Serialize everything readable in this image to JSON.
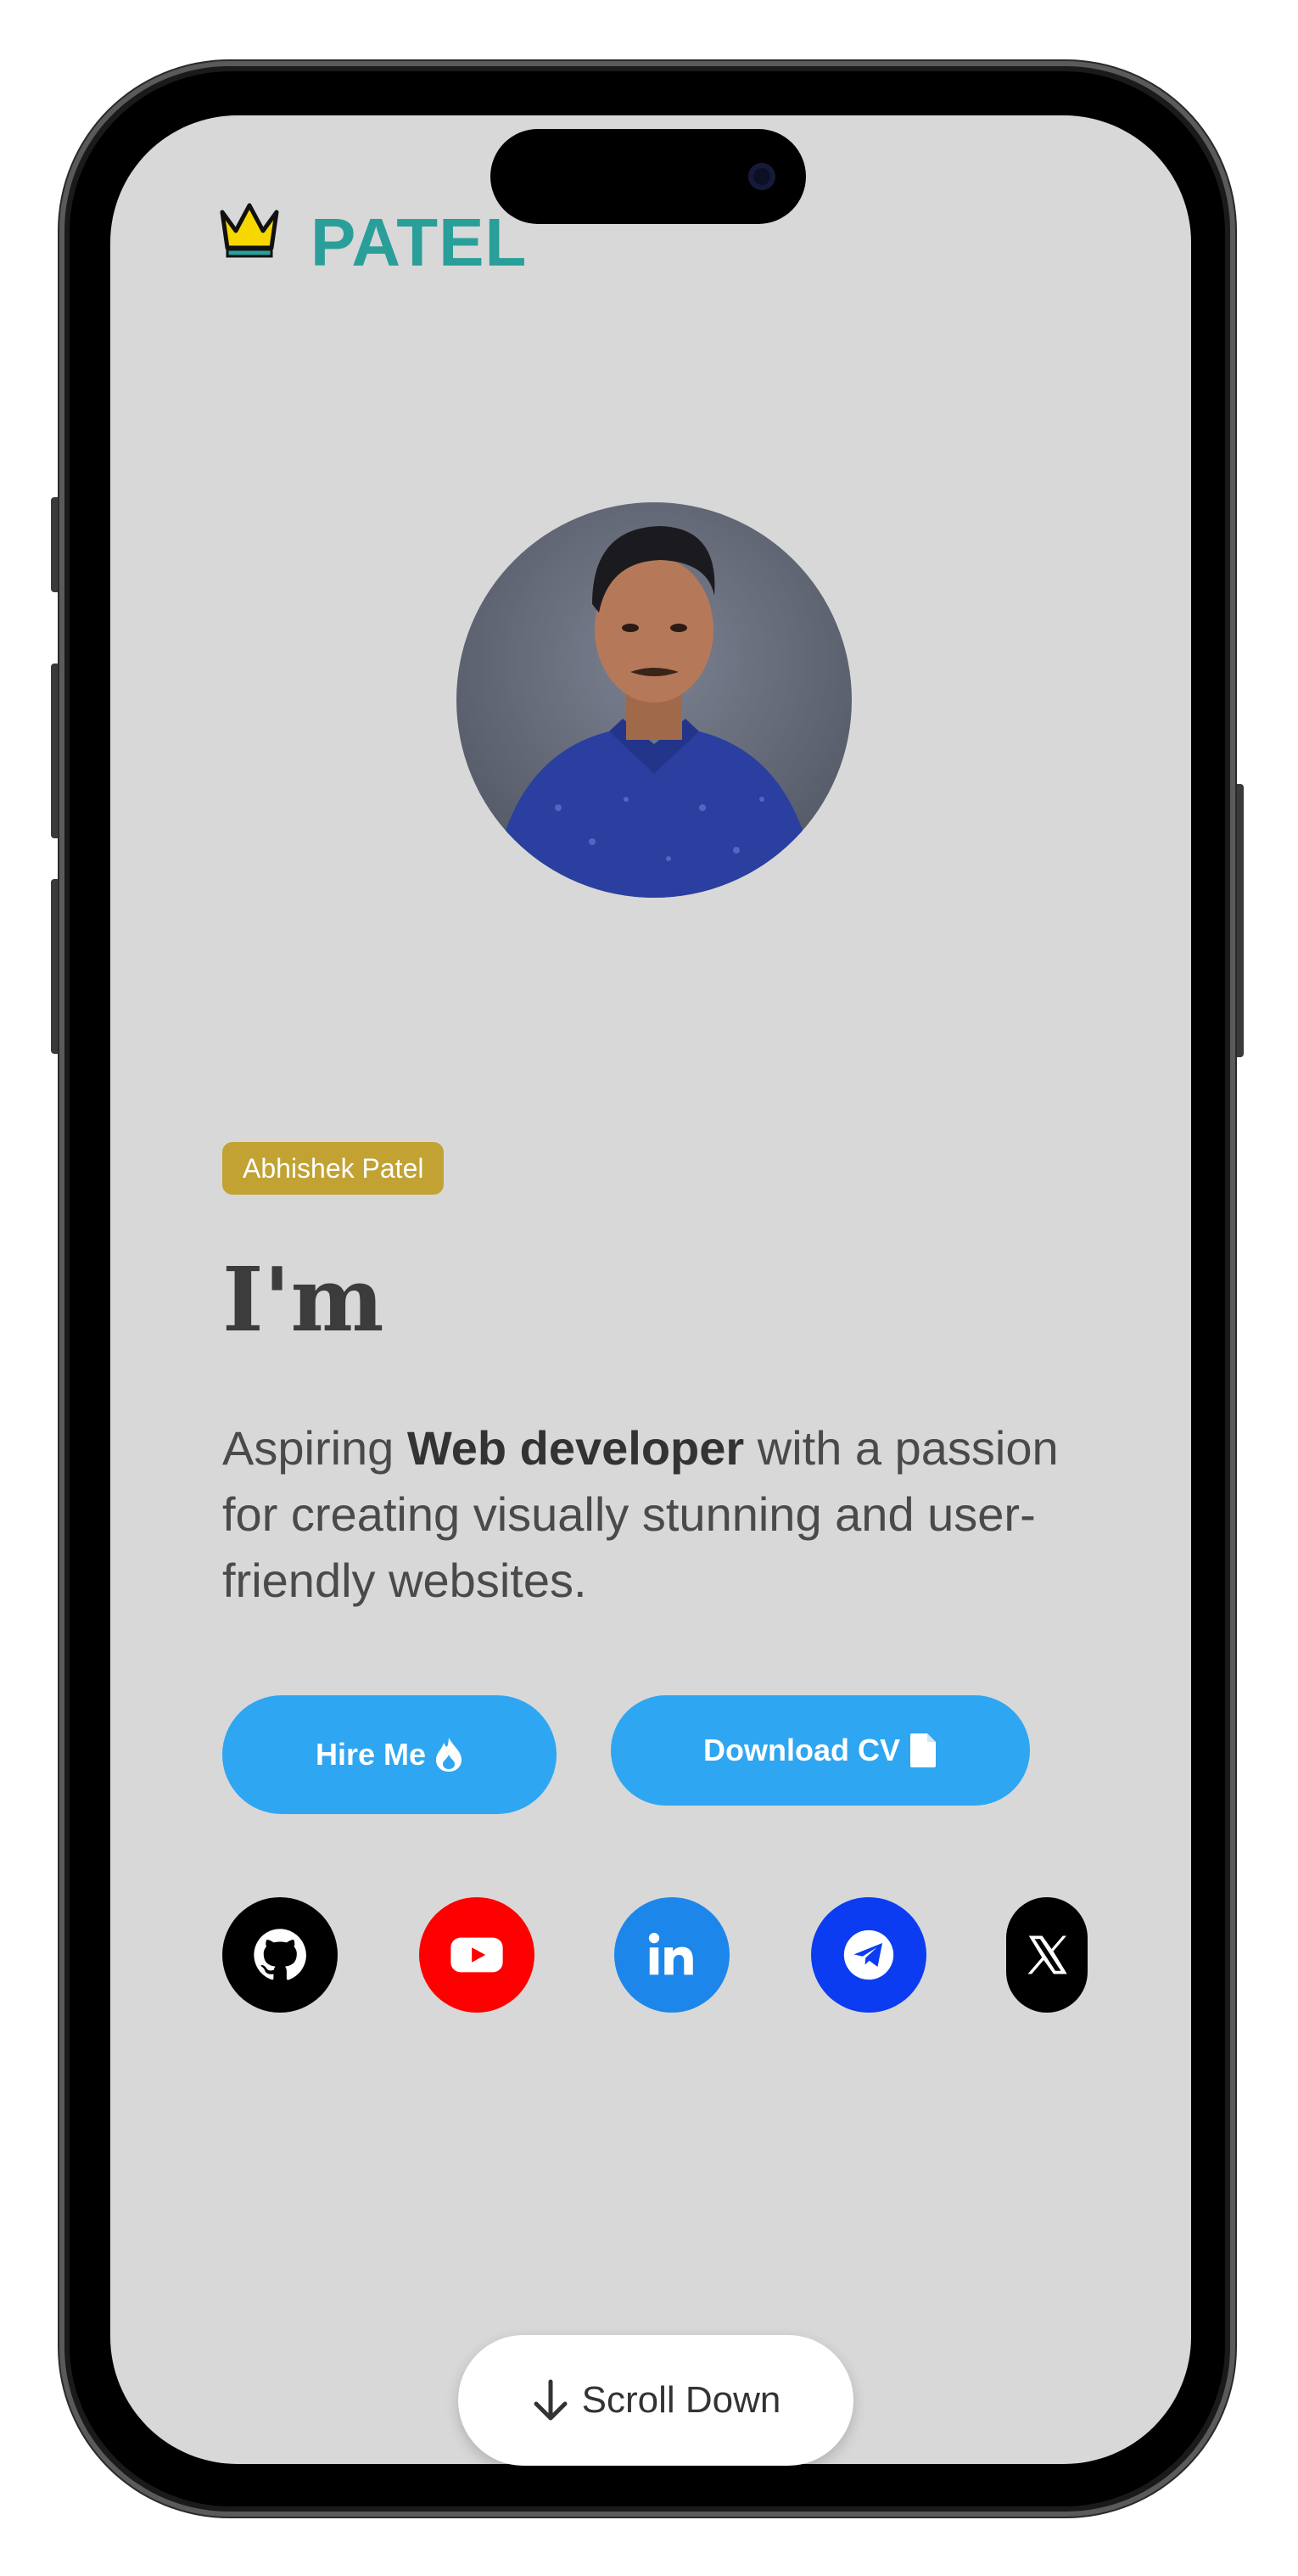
{
  "brand": {
    "logo_text": "PATEL",
    "logo_icon": "crown-icon",
    "logo_color": "#2a9f9a"
  },
  "hero": {
    "badge": "Abhishek Patel",
    "heading": "I'm",
    "description_prefix": "Aspiring ",
    "description_bold": "Web developer",
    "description_suffix": " with a passion for creating visually stunning and user-friendly websites."
  },
  "buttons": {
    "hire_label": "Hire Me",
    "hire_icon": "flame-icon",
    "cv_label": "Download CV",
    "cv_icon": "document-icon",
    "accent": "#2ea6f2"
  },
  "social": [
    {
      "name": "github",
      "icon": "github-icon",
      "color": "#000000"
    },
    {
      "name": "youtube",
      "icon": "youtube-icon",
      "color": "#ff0000"
    },
    {
      "name": "linkedin",
      "icon": "linkedin-icon",
      "color": "#1d86ea"
    },
    {
      "name": "telegram",
      "icon": "telegram-icon",
      "color": "#0b3cf1"
    },
    {
      "name": "x",
      "icon": "x-icon",
      "color": "#000000"
    }
  ],
  "scroll": {
    "label": "Scroll Down",
    "icon": "arrow-down-icon"
  }
}
